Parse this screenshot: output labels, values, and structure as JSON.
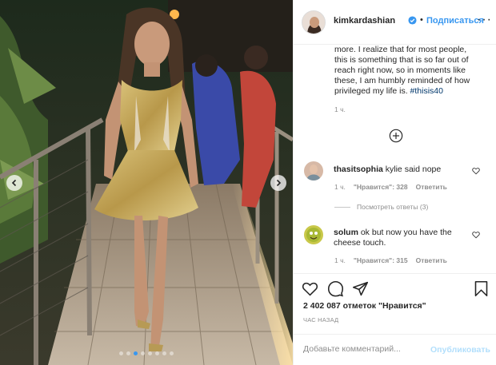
{
  "post": {
    "username": "kimkardashian",
    "follow_label": "Подписаться",
    "separator": "•",
    "more_label": "···",
    "caption_lines": [
      "more. I realize that for most people,",
      "this is something that is so far out of",
      "reach right now, so in moments like",
      "these, I am humbly reminded of how",
      "privileged my life is."
    ],
    "caption_hashtag": "#thisis40",
    "caption_time": "1 ч."
  },
  "comments": [
    {
      "username": "thasitsophia",
      "text": "kylie said nope",
      "time": "1 ч.",
      "likes": "\"Нравится\": 328",
      "reply": "Ответить",
      "view_replies": "Посмотреть ответы (3)"
    },
    {
      "username": "solum",
      "text": "ok but now you have the cheese touch.",
      "time": "1 ч.",
      "likes": "\"Нравится\": 315",
      "reply": "Ответить"
    }
  ],
  "stats": {
    "likes": "2 402 087 отметок \"Нравится\"",
    "posted": "ЧАС НАЗАД"
  },
  "composer": {
    "placeholder": "Добавьте комментарий...",
    "publish_label": "Опубликовать"
  },
  "carousel": {
    "total": 8,
    "active_index": 2
  },
  "icons": {
    "like": "heart-icon",
    "comment": "comment-icon",
    "share": "share-icon",
    "save": "bookmark-icon",
    "verified": "verified-badge-icon",
    "load_more": "plus-circle-icon"
  },
  "colors": {
    "link_blue": "#3897f0",
    "publish_disabled": "#b2dffc",
    "muted": "#8e8e8e",
    "hashtag": "#00376b"
  }
}
